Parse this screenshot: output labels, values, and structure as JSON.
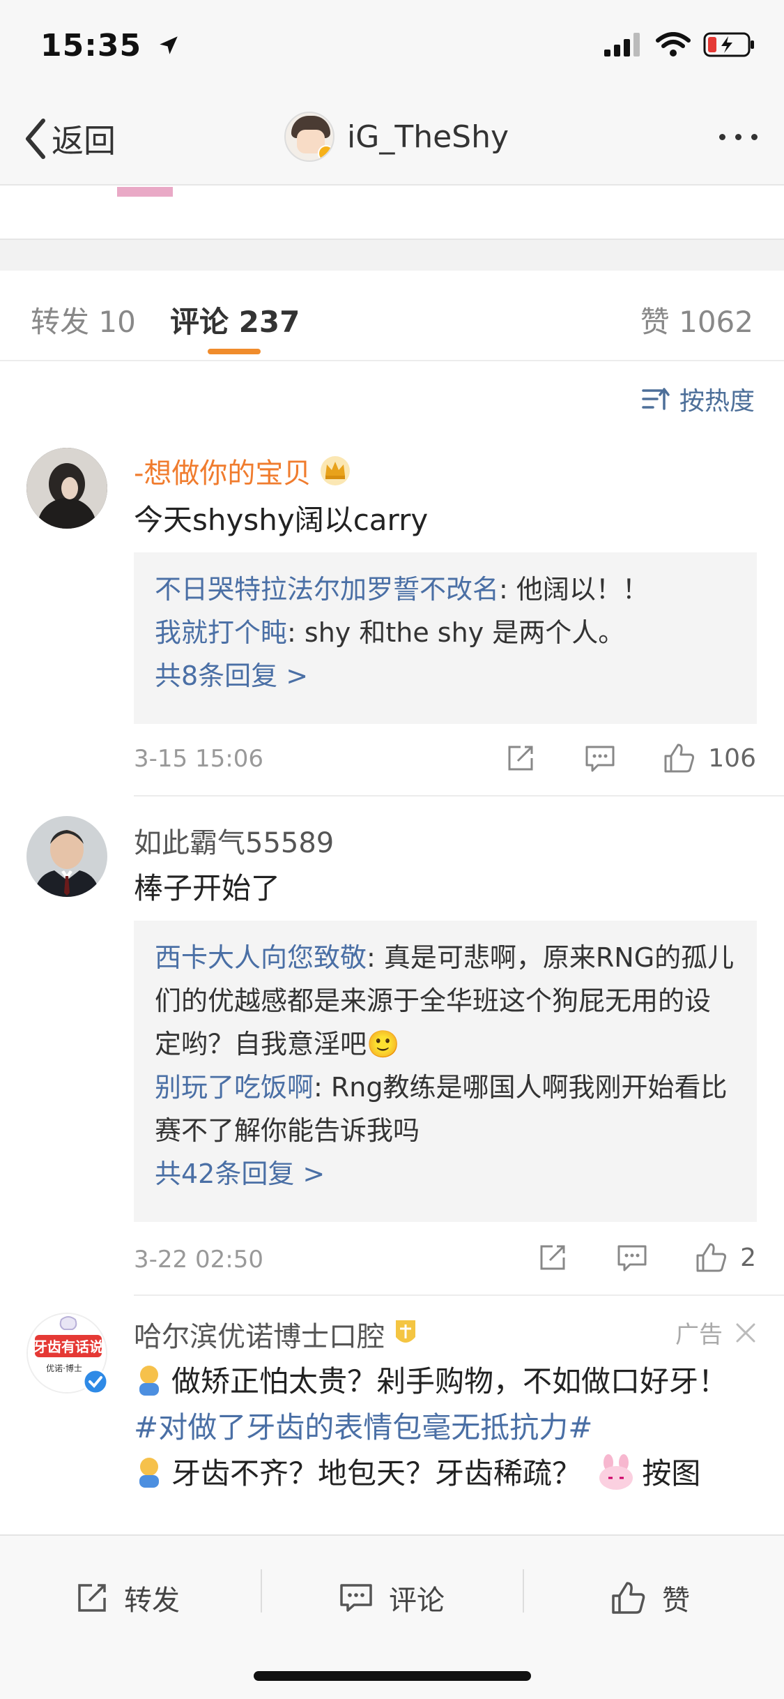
{
  "status": {
    "time": "15:35"
  },
  "nav": {
    "back_label": "返回",
    "title": "iG_TheShy"
  },
  "tabs": {
    "repost": "转发 10",
    "comment": "评论 237",
    "like": "赞 1062"
  },
  "sort_label": "按热度",
  "comments": [
    {
      "name": "-想做你的宝贝",
      "text": "今天shyshy阔以carry",
      "replies": [
        {
          "who": "不日哭特拉法尔加罗誓不改名",
          "text": ": 他阔以！！"
        },
        {
          "who": "我就打个盹",
          "text": ": shy  和the  shy  是两个人。"
        }
      ],
      "more": "共8条回复 >",
      "time": "3-15 15:06",
      "likes": "106"
    },
    {
      "name": "如此霸气55589",
      "text": "棒子开始了",
      "replies": [
        {
          "who": "西卡大人向您致敬",
          "text": ": 真是可悲啊，原来RNG的孤儿们的优越感都是来源于全华班这个狗屁无用的设定哟？自我意淫吧🙂"
        },
        {
          "who": "别玩了吃饭啊",
          "text": ": Rng教练是哪国人啊我刚开始看比赛不了解你能告诉我吗"
        }
      ],
      "more": "共42条回复 >",
      "time": "3-22 02:50",
      "likes": "2"
    },
    {
      "name": "哈尔滨优诺博士口腔",
      "ad_label": "广告",
      "avatar_text": "牙齿有话说",
      "avatar_sub": "优诺·博士",
      "line1": "做矫正怕太贵？剁手购物，不如做口好牙！",
      "hashtag": "#对做了牙齿的表情包毫无抵抗力#",
      "line2": "牙齿不齐？地包天？牙齿稀疏？",
      "line2_tail": "按图"
    }
  ],
  "bottom": {
    "repost": "转发",
    "comment": "评论",
    "like": "赞"
  }
}
